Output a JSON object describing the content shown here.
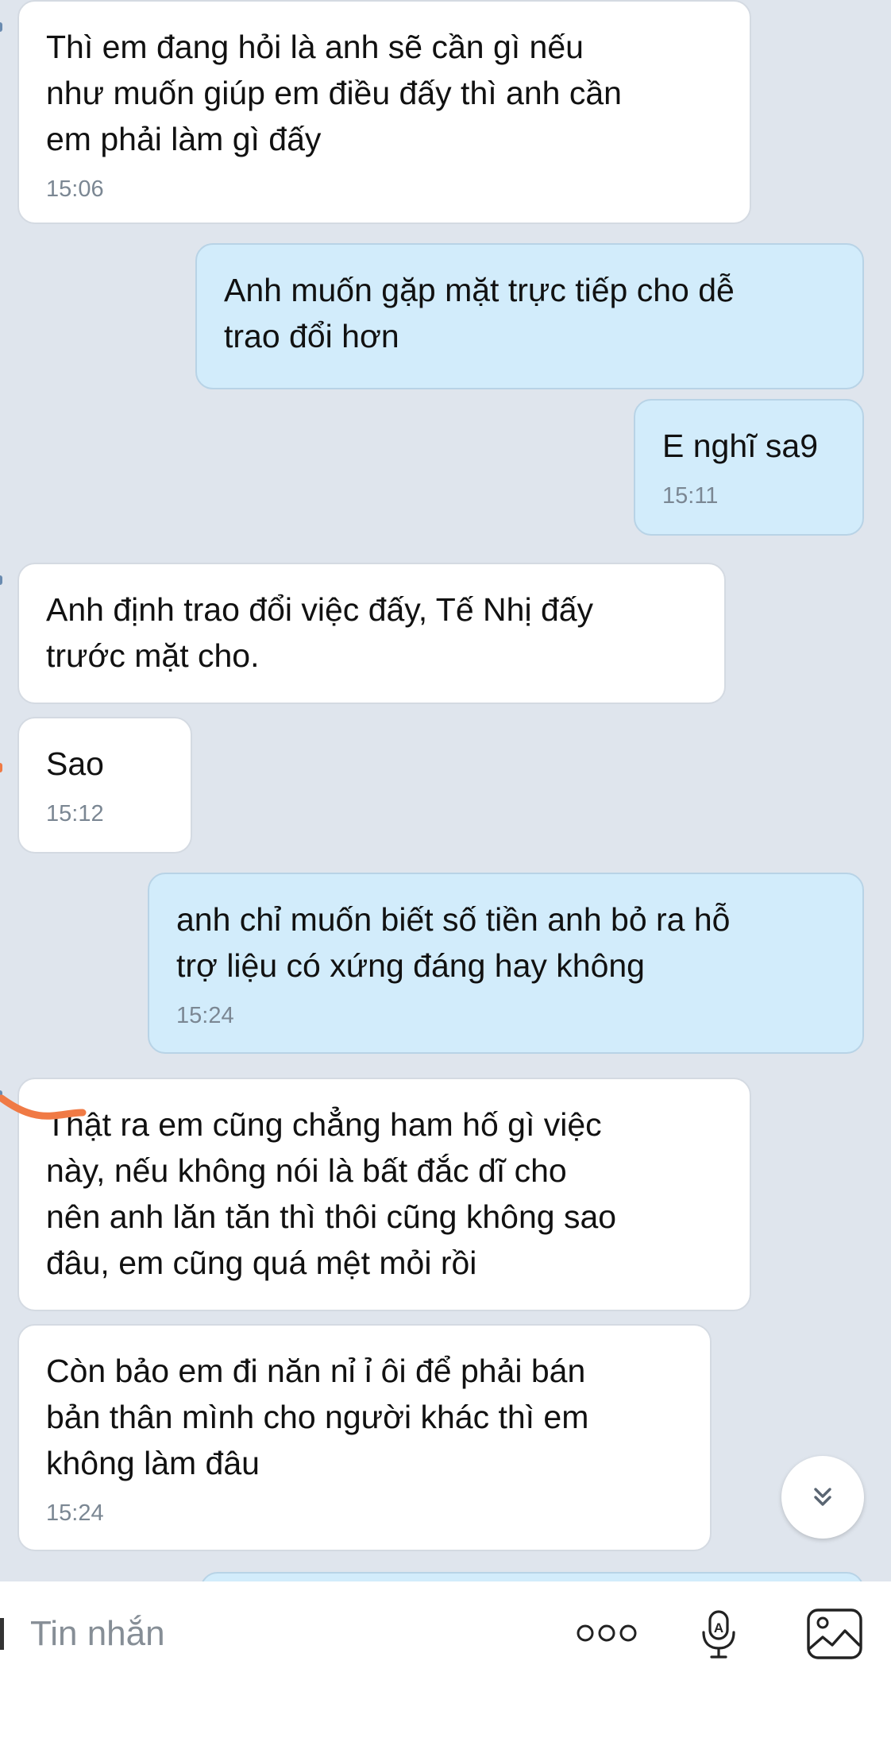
{
  "messages": [
    {
      "side": "in",
      "text": "Thì em đang hỏi là anh sẽ cần gì nếu\nnhư muốn giúp em điều đấy thì anh cần\nem phải làm gì đấy",
      "time": "15:06"
    },
    {
      "side": "out",
      "text": "Anh muốn gặp mặt trực tiếp cho dễ\ntrao đổi hơn",
      "time": ""
    },
    {
      "side": "out",
      "text": "E nghĩ sa9",
      "time": "15:11"
    },
    {
      "side": "in",
      "text": "Anh định trao đổi việc đấy, Tế Nhị đấy\ntrước mặt cho.",
      "time": ""
    },
    {
      "side": "in",
      "text": "Sao",
      "time": "15:12"
    },
    {
      "side": "out",
      "text": "anh chỉ muốn biết số tiền anh bỏ ra hỗ\ntrợ liệu có xứng đáng hay không",
      "time": "15:24"
    },
    {
      "side": "in",
      "text": "Thật ra em cũng chẳng ham hố gì việc\nnày, nếu không nói là bất đắc dĩ cho\nnên anh lăn tăn thì thôi cũng không sao\nđâu, em cũng quá mệt mỏi rồi",
      "time": ""
    },
    {
      "side": "in",
      "text": "Còn bảo em đi năn nỉ ỉ ôi để phải bán\nbản thân mình cho người khác thì em\nkhông làm đâu",
      "time": "15:24"
    }
  ],
  "composer": {
    "placeholder": "Tin nhắn",
    "icons": [
      "more-dots-icon",
      "voice-to-text-icon",
      "image-icon"
    ]
  },
  "scroll_down_icon": "double-chevron-down-icon",
  "colors": {
    "background": "#dfe5ed",
    "incoming_bubble": "#ffffff",
    "outgoing_bubble": "#d2ecfb",
    "timestamp": "#7b8793",
    "annotation": "#f07a45"
  }
}
